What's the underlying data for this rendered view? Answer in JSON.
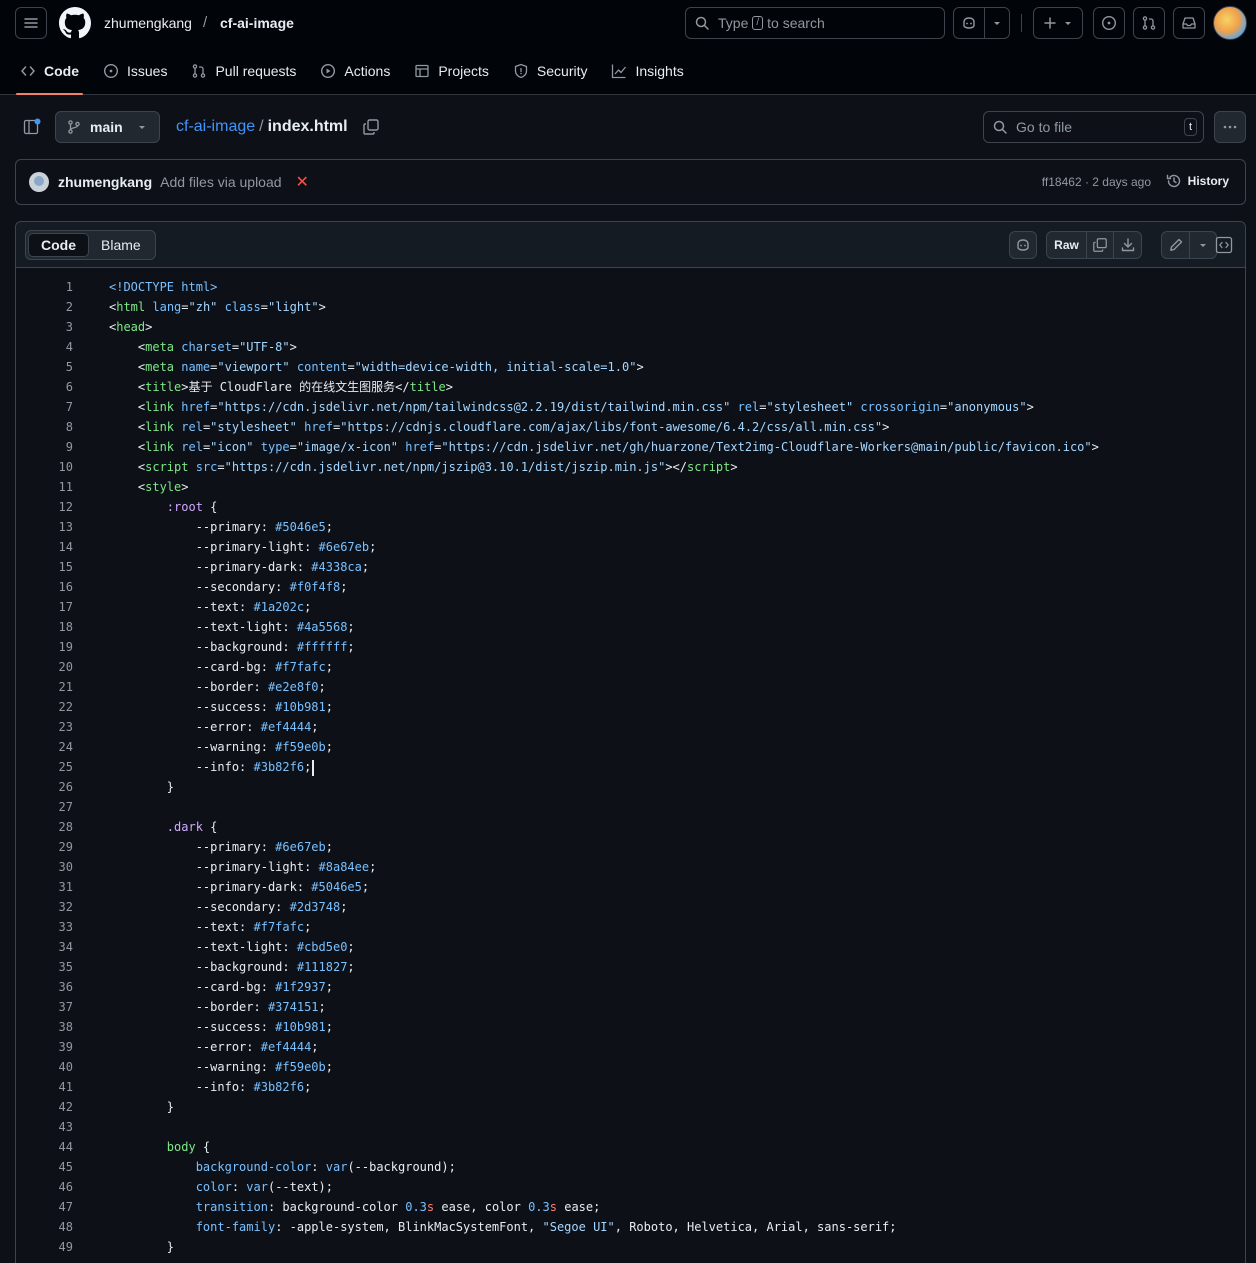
{
  "header": {
    "owner": "zhumengkang",
    "slash": "/",
    "repo": "cf-ai-image",
    "search_prefix": "Type",
    "search_key": "/",
    "search_suffix": "to search"
  },
  "nav": {
    "code": "Code",
    "issues": "Issues",
    "pull_requests": "Pull requests",
    "actions": "Actions",
    "projects": "Projects",
    "security": "Security",
    "insights": "Insights"
  },
  "file_header": {
    "branch": "main",
    "repo_link": "cf-ai-image",
    "path_sep": "/",
    "file_name": "index.html",
    "goto_placeholder": "Go to file",
    "goto_key": "t"
  },
  "commit": {
    "author": "zhumengkang",
    "message": "Add files via upload",
    "status_mark": "✕",
    "meta": "ff18462 · 2 days ago",
    "history": "History"
  },
  "file_toolbar": {
    "tab_code": "Code",
    "tab_blame": "Blame",
    "raw": "Raw"
  },
  "colors": {
    "accent_underline": "#f78166",
    "link": "#4493f8",
    "tag": "#7ee787",
    "attr": "#79c0ff",
    "string": "#a5d6ff",
    "selector": "#d2a8ff"
  },
  "code_lines": [
    [
      [
        "t-attr",
        "<!DOCTYPE html>"
      ]
    ],
    [
      [
        "",
        "<"
      ],
      [
        "t-tag",
        "html"
      ],
      [
        "t-attr",
        " lang"
      ],
      [
        "",
        "="
      ],
      [
        "t-str",
        "\"zh\""
      ],
      [
        "t-attr",
        " class"
      ],
      [
        "",
        "="
      ],
      [
        "t-str",
        "\"light\""
      ],
      [
        "",
        ">"
      ]
    ],
    [
      [
        "",
        "<"
      ],
      [
        "t-tag",
        "head"
      ],
      [
        "",
        ">"
      ]
    ],
    [
      [
        "",
        "    <"
      ],
      [
        "t-tag",
        "meta"
      ],
      [
        "t-attr",
        " charset"
      ],
      [
        "",
        "="
      ],
      [
        "t-str",
        "\"UTF-8\""
      ],
      [
        "",
        ">"
      ]
    ],
    [
      [
        "",
        "    <"
      ],
      [
        "t-tag",
        "meta"
      ],
      [
        "t-attr",
        " name"
      ],
      [
        "",
        "="
      ],
      [
        "t-str",
        "\"viewport\""
      ],
      [
        "t-attr",
        " content"
      ],
      [
        "",
        "="
      ],
      [
        "t-str",
        "\"width=device-width, initial-scale=1.0\""
      ],
      [
        "",
        ">"
      ]
    ],
    [
      [
        "",
        "    <"
      ],
      [
        "t-tag",
        "title"
      ],
      [
        "",
        ">基于 CloudFlare 的在线文生图服务</"
      ],
      [
        "t-tag",
        "title"
      ],
      [
        "",
        ">"
      ]
    ],
    [
      [
        "",
        "    <"
      ],
      [
        "t-tag",
        "link"
      ],
      [
        "t-attr",
        " href"
      ],
      [
        "",
        "="
      ],
      [
        "t-str",
        "\"https://cdn.jsdelivr.net/npm/tailwindcss@2.2.19/dist/tailwind.min.css\""
      ],
      [
        "t-attr",
        " rel"
      ],
      [
        "",
        "="
      ],
      [
        "t-str",
        "\"stylesheet\""
      ],
      [
        "t-attr",
        " crossorigin"
      ],
      [
        "",
        "="
      ],
      [
        "t-str",
        "\"anonymous\""
      ],
      [
        "",
        ">"
      ]
    ],
    [
      [
        "",
        "    <"
      ],
      [
        "t-tag",
        "link"
      ],
      [
        "t-attr",
        " rel"
      ],
      [
        "",
        "="
      ],
      [
        "t-str",
        "\"stylesheet\""
      ],
      [
        "t-attr",
        " href"
      ],
      [
        "",
        "="
      ],
      [
        "t-str",
        "\"https://cdnjs.cloudflare.com/ajax/libs/font-awesome/6.4.2/css/all.min.css\""
      ],
      [
        "",
        ">"
      ]
    ],
    [
      [
        "",
        "    <"
      ],
      [
        "t-tag",
        "link"
      ],
      [
        "t-attr",
        " rel"
      ],
      [
        "",
        "="
      ],
      [
        "t-str",
        "\"icon\""
      ],
      [
        "t-attr",
        " type"
      ],
      [
        "",
        "="
      ],
      [
        "t-str",
        "\"image/x-icon\""
      ],
      [
        "t-attr",
        " href"
      ],
      [
        "",
        "="
      ],
      [
        "t-str",
        "\"https://cdn.jsdelivr.net/gh/huarzone/Text2img-Cloudflare-Workers@main/public/favicon.ico\""
      ],
      [
        "",
        ">"
      ]
    ],
    [
      [
        "",
        "    <"
      ],
      [
        "t-tag",
        "script"
      ],
      [
        "t-attr",
        " src"
      ],
      [
        "",
        "="
      ],
      [
        "t-str",
        "\"https://cdn.jsdelivr.net/npm/jszip@3.10.1/dist/jszip.min.js\""
      ],
      [
        "",
        "></"
      ],
      [
        "t-tag",
        "script"
      ],
      [
        "",
        ">"
      ]
    ],
    [
      [
        "",
        "    <"
      ],
      [
        "t-tag",
        "style"
      ],
      [
        "",
        ">"
      ]
    ],
    [
      [
        "",
        "        "
      ],
      [
        "t-sel",
        ":root"
      ],
      [
        "",
        " {"
      ]
    ],
    [
      [
        "",
        "            --primary: "
      ],
      [
        "t-num",
        "#5046e5"
      ],
      [
        "",
        ";"
      ]
    ],
    [
      [
        "",
        "            --primary-light: "
      ],
      [
        "t-num",
        "#6e67eb"
      ],
      [
        "",
        ";"
      ]
    ],
    [
      [
        "",
        "            --primary-dark: "
      ],
      [
        "t-num",
        "#4338ca"
      ],
      [
        "",
        ";"
      ]
    ],
    [
      [
        "",
        "            --secondary: "
      ],
      [
        "t-num",
        "#f0f4f8"
      ],
      [
        "",
        ";"
      ]
    ],
    [
      [
        "",
        "            --text: "
      ],
      [
        "t-num",
        "#1a202c"
      ],
      [
        "",
        ";"
      ]
    ],
    [
      [
        "",
        "            --text-light: "
      ],
      [
        "t-num",
        "#4a5568"
      ],
      [
        "",
        ";"
      ]
    ],
    [
      [
        "",
        "            --background: "
      ],
      [
        "t-num",
        "#ffffff"
      ],
      [
        "",
        ";"
      ]
    ],
    [
      [
        "",
        "            --card-bg: "
      ],
      [
        "t-num",
        "#f7fafc"
      ],
      [
        "",
        ";"
      ]
    ],
    [
      [
        "",
        "            --border: "
      ],
      [
        "t-num",
        "#e2e8f0"
      ],
      [
        "",
        ";"
      ]
    ],
    [
      [
        "",
        "            --success: "
      ],
      [
        "t-num",
        "#10b981"
      ],
      [
        "",
        ";"
      ]
    ],
    [
      [
        "",
        "            --error: "
      ],
      [
        "t-num",
        "#ef4444"
      ],
      [
        "",
        ";"
      ]
    ],
    [
      [
        "",
        "            --warning: "
      ],
      [
        "t-num",
        "#f59e0b"
      ],
      [
        "",
        ";"
      ]
    ],
    [
      [
        "",
        "            --info: "
      ],
      [
        "t-num",
        "#3b82f6"
      ],
      [
        "",
        ";"
      ]
    ],
    [
      [
        "",
        "        }"
      ]
    ],
    [
      [
        "",
        ""
      ]
    ],
    [
      [
        "",
        "        "
      ],
      [
        "t-sel",
        ".dark"
      ],
      [
        "",
        " {"
      ]
    ],
    [
      [
        "",
        "            --primary: "
      ],
      [
        "t-num",
        "#6e67eb"
      ],
      [
        "",
        ";"
      ]
    ],
    [
      [
        "",
        "            --primary-light: "
      ],
      [
        "t-num",
        "#8a84ee"
      ],
      [
        "",
        ";"
      ]
    ],
    [
      [
        "",
        "            --primary-dark: "
      ],
      [
        "t-num",
        "#5046e5"
      ],
      [
        "",
        ";"
      ]
    ],
    [
      [
        "",
        "            --secondary: "
      ],
      [
        "t-num",
        "#2d3748"
      ],
      [
        "",
        ";"
      ]
    ],
    [
      [
        "",
        "            --text: "
      ],
      [
        "t-num",
        "#f7fafc"
      ],
      [
        "",
        ";"
      ]
    ],
    [
      [
        "",
        "            --text-light: "
      ],
      [
        "t-num",
        "#cbd5e0"
      ],
      [
        "",
        ";"
      ]
    ],
    [
      [
        "",
        "            --background: "
      ],
      [
        "t-num",
        "#111827"
      ],
      [
        "",
        ";"
      ]
    ],
    [
      [
        "",
        "            --card-bg: "
      ],
      [
        "t-num",
        "#1f2937"
      ],
      [
        "",
        ";"
      ]
    ],
    [
      [
        "",
        "            --border: "
      ],
      [
        "t-num",
        "#374151"
      ],
      [
        "",
        ";"
      ]
    ],
    [
      [
        "",
        "            --success: "
      ],
      [
        "t-num",
        "#10b981"
      ],
      [
        "",
        ";"
      ]
    ],
    [
      [
        "",
        "            --error: "
      ],
      [
        "t-num",
        "#ef4444"
      ],
      [
        "",
        ";"
      ]
    ],
    [
      [
        "",
        "            --warning: "
      ],
      [
        "t-num",
        "#f59e0b"
      ],
      [
        "",
        ";"
      ]
    ],
    [
      [
        "",
        "            --info: "
      ],
      [
        "t-num",
        "#3b82f6"
      ],
      [
        "",
        ";"
      ]
    ],
    [
      [
        "",
        "        }"
      ]
    ],
    [
      [
        "",
        ""
      ]
    ],
    [
      [
        "",
        "        "
      ],
      [
        "t-tag",
        "body"
      ],
      [
        "",
        " {"
      ]
    ],
    [
      [
        "",
        "            "
      ],
      [
        "t-prop",
        "background-color"
      ],
      [
        "",
        ": "
      ],
      [
        "t-prop",
        "var"
      ],
      [
        "",
        "(--background);"
      ]
    ],
    [
      [
        "",
        "            "
      ],
      [
        "t-prop",
        "color"
      ],
      [
        "",
        ": "
      ],
      [
        "t-prop",
        "var"
      ],
      [
        "",
        "(--text);"
      ]
    ],
    [
      [
        "",
        "            "
      ],
      [
        "t-prop",
        "transition"
      ],
      [
        "",
        ": background-color "
      ],
      [
        "t-num",
        "0.3"
      ],
      [
        "t-kw",
        "s"
      ],
      [
        "",
        " ease, color "
      ],
      [
        "t-num",
        "0.3"
      ],
      [
        "t-kw",
        "s"
      ],
      [
        "",
        " ease;"
      ]
    ],
    [
      [
        "",
        "            "
      ],
      [
        "t-prop",
        "font-family"
      ],
      [
        "",
        ": -apple-system, BlinkMacSystemFont, "
      ],
      [
        "t-str",
        "\"Segoe UI\""
      ],
      [
        "",
        ", Roboto, Helvetica, Arial, sans-serif;"
      ]
    ],
    [
      [
        "",
        "        }"
      ]
    ]
  ]
}
